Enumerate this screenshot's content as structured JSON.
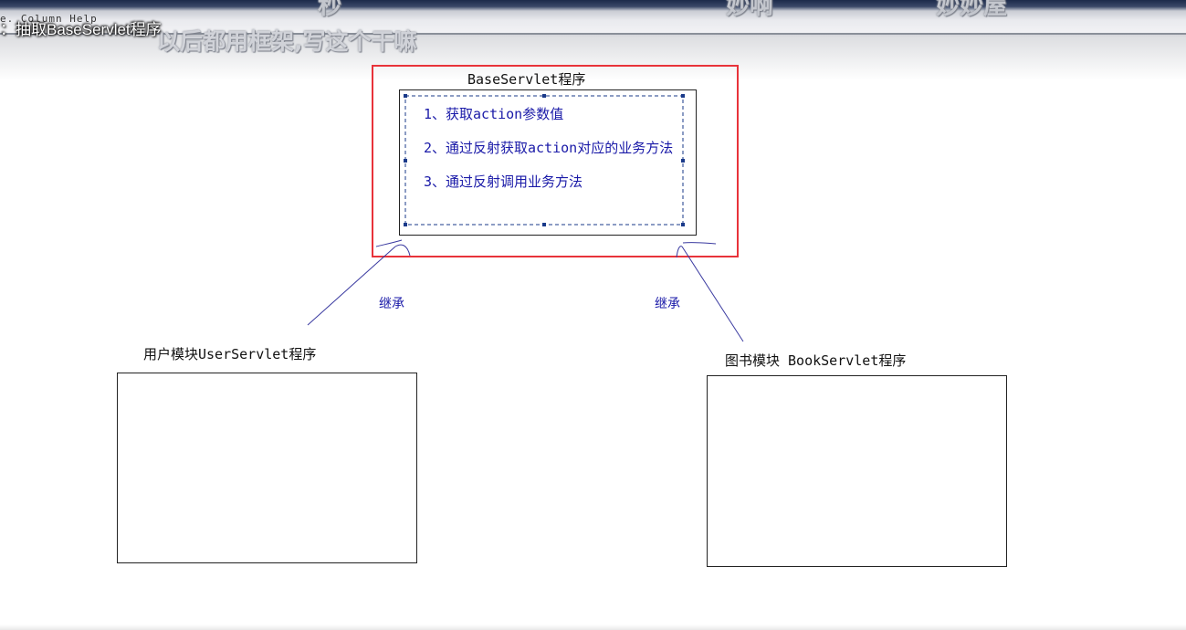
{
  "video": {
    "menu_text": "e. Column  Help",
    "title": "：抽取BaseServlet程序"
  },
  "danmaku": [
    "秒",
    "妙啊",
    "妙妙屋",
    "以后都用框架,写这个干嘛"
  ],
  "diagram": {
    "base": {
      "title": "BaseServlet程序",
      "steps": [
        "1、获取action参数值",
        "2、通过反射获取action对应的业务方法",
        "3、通过反射调用业务方法"
      ]
    },
    "edges": [
      {
        "from": "用户模块UserServlet程序",
        "to": "BaseServlet程序",
        "label": "继承"
      },
      {
        "from": "图书模块 BookServlet程序",
        "to": "BaseServlet程序",
        "label": "继承"
      }
    ],
    "user_module": {
      "title": "用户模块UserServlet程序"
    },
    "book_module": {
      "title": "图书模块 BookServlet程序"
    },
    "colors": {
      "highlight": "#e8333a",
      "annotation": "#1a1aa8",
      "outline": "#222222"
    }
  }
}
